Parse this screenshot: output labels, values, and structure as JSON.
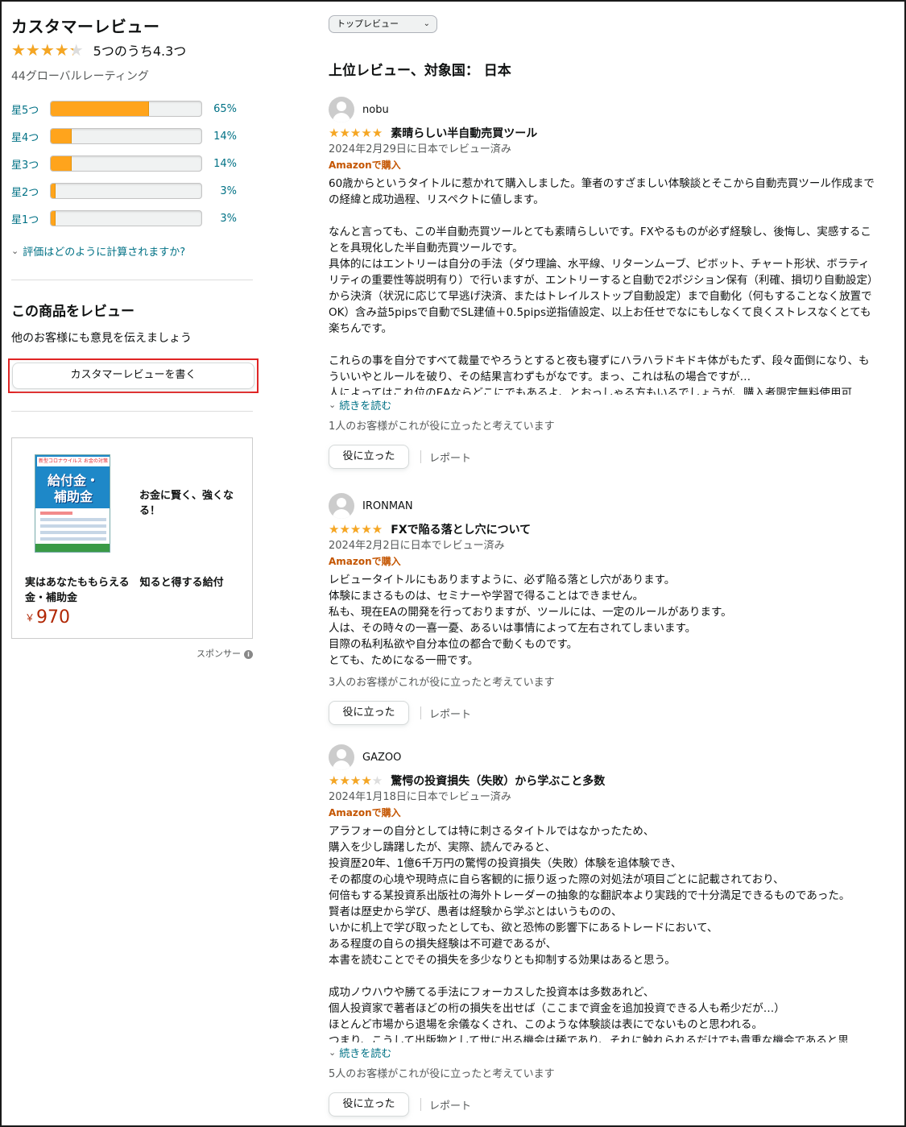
{
  "summary": {
    "title": "カスタマーレビュー",
    "rating_value": 4.3,
    "rating_text": "5つのうち4.3つ",
    "global_count": "44グローバルレーティング",
    "histogram": [
      {
        "label": "星5つ",
        "pct_text": "65%",
        "pct": 65
      },
      {
        "label": "星4つ",
        "pct_text": "14%",
        "pct": 14
      },
      {
        "label": "星3つ",
        "pct_text": "14%",
        "pct": 14
      },
      {
        "label": "星2つ",
        "pct_text": "3%",
        "pct": 3
      },
      {
        "label": "星1つ",
        "pct_text": "3%",
        "pct": 3
      }
    ],
    "how_calculated": "評価はどのように計算されますか?"
  },
  "write_review": {
    "title": "この商品をレビュー",
    "subtitle": "他のお客様にも意見を伝えましょう",
    "button": "カスタマーレビューを書く"
  },
  "ad": {
    "cover_top": "新型コロナウイルス",
    "cover_top_accent": "お金の対策",
    "cover_title_1": "給付金・",
    "cover_title_2": "補助金",
    "tagline": "お金に賢く、強くなる！",
    "product_name": "実はあなたももらえる　知ると得する給付金・補助金",
    "currency": "￥",
    "price": "970",
    "sponsor": "スポンサー",
    "info_icon": "i"
  },
  "reviews_panel": {
    "sort_selected": "トップレビュー",
    "heading": "上位レビュー、対象国： 日本"
  },
  "icons": {
    "chevron_down": "⌄",
    "star_full": "★★★★★"
  },
  "reviews": [
    {
      "author": "nobu",
      "stars": 5,
      "title": "素晴らしい半自動売買ツール",
      "date": "2024年2月29日に日本でレビュー済み",
      "verified": "Amazonで購入",
      "body": "60歳からというタイトルに惹かれて購入しました。筆者のすざましい体験談とそこから自動売買ツール作成までの経緯と成功過程、リスペクトに値します。\n\nなんと言っても、この半自動売買ツールとても素晴らしいです。FXやるものが必ず経験し、後悔し、実感することを具現化した半自動売買ツールです。\n具体的にはエントリーは自分の手法（ダウ理論、水平線、リターンムーブ、ピボット、チャート形状、ボラティリティの重要性等説明有り）で行いますが、エントリーすると自動で2ポジション保有（利確、損切り自動設定）から決済（状況に応じて早逃げ決済、またはトレイルストップ自動設定）まで自動化（何もすることなく放置でOK）含み益5pipsで自動でSL建値＋0.5pips逆指値設定、以上お任せでなにもしなくて良くストレスなくとても楽ちんです。\n\nこれらの事を自分ですべて裁量でやろうとすると夜も寝ずにハラハラドキドキ体がもたず、段々面倒になり、もういいやとルールを破り、その結果言わずもがなです。まっ、これは私の場合ですが…\n人によってはこれ位のEAならどこにでもあるよ、とおっしゃる方もいるでしょうが、購入者限定無料使用可",
      "read_more": "続きを読む",
      "helpful": "1人のお客様がこれが役に立ったと考えています",
      "helpful_button": "役に立った",
      "report": "レポート"
    },
    {
      "author": "IRONMAN",
      "stars": 5,
      "title": "FXで陥る落とし穴について",
      "date": "2024年2月2日に日本でレビュー済み",
      "verified": "Amazonで購入",
      "body": "レビュータイトルにもありますように、必ず陥る落とし穴があります。\n体験にまさるものは、セミナーや学習で得ることはできません。\n私も、現在EAの開発を行っておりますが、ツールには、一定のルールがあります。\n人は、その時々の一喜一憂、あるいは事情によって左右されてしまいます。\n目際の私利私欲や自分本位の都合で動くものです。\nとても、ためになる一冊です。",
      "helpful": "3人のお客様がこれが役に立ったと考えています",
      "helpful_button": "役に立った",
      "report": "レポート"
    },
    {
      "author": "GAZOO",
      "stars": 4,
      "title": "驚愕の投資損失（失敗）から学ぶこと多数",
      "date": "2024年1月18日に日本でレビュー済み",
      "verified": "Amazonで購入",
      "body": "アラフォーの自分としては特に刺さるタイトルではなかったため、\n購入を少し躊躇したが、実際、読んでみると、\n投資歴20年、1億6千万円の驚愕の投資損失（失敗）体験を追体験でき、\nその都度の心境や現時点に自ら客観的に振り返った際の対処法が項目ごとに記載されており、\n何倍もする某投資系出版社の海外トレーダーの抽象的な翻訳本より実践的で十分満足できるものであった。\n賢者は歴史から学び、愚者は経験から学ぶとはいうものの、\nいかに机上で学び取ったとしても、欲と恐怖の影響下にあるトレードにおいて、\nある程度の自らの損失経験は不可避であるが、\n本書を読むことでその損失を多少なりとも抑制する効果はあると思う。\n\n成功ノウハウや勝てる手法にフォーカスした投資本は多数あれど、\n個人投資家で著者ほどの桁の損失を出せば（ここまで資金を追加投資できる人も希少だが…）\nほとんど市場から退場を余儀なくされ、このような体験談は表にでないものと思われる。\nつまり、こうして出版物として世に出る機会は稀であり、それに触れられるだけでも貴重な機会であると思",
      "read_more": "続きを読む",
      "helpful": "5人のお客様がこれが役に立ったと考えています",
      "helpful_button": "役に立った",
      "report": "レポート"
    }
  ]
}
